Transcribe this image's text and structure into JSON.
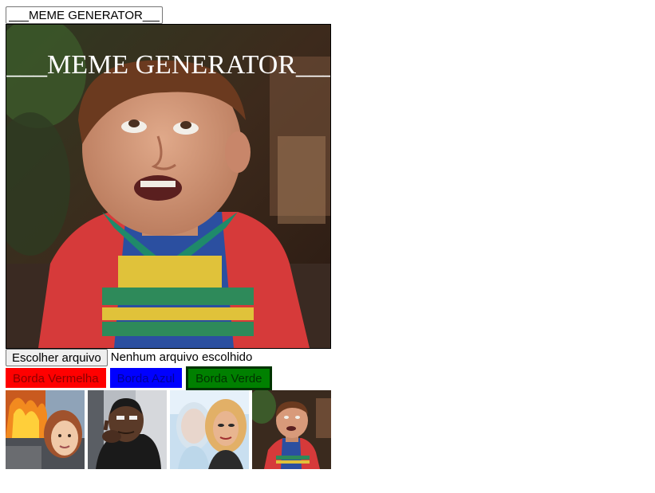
{
  "meme_text_input": {
    "value": "___MEME GENERATOR___"
  },
  "meme": {
    "caption": "___MEME GENERATOR___"
  },
  "file_input": {
    "button_label": "Escolher arquivo",
    "status": "Nenhum arquivo escolhido"
  },
  "border_buttons": {
    "red_label": "Borda Vermelha",
    "blue_label": "Borda Azul",
    "green_label": "Borda Verde"
  },
  "colors": {
    "red": "#ff0000",
    "blue": "#0000ff",
    "green": "#008000"
  },
  "thumbnails": [
    {
      "icon": "disaster-girl-meme-thumbnail"
    },
    {
      "icon": "thinking-man-meme-thumbnail"
    },
    {
      "icon": "two-women-meme-thumbnail"
    },
    {
      "icon": "disgusted-kid-meme-thumbnail"
    }
  ]
}
